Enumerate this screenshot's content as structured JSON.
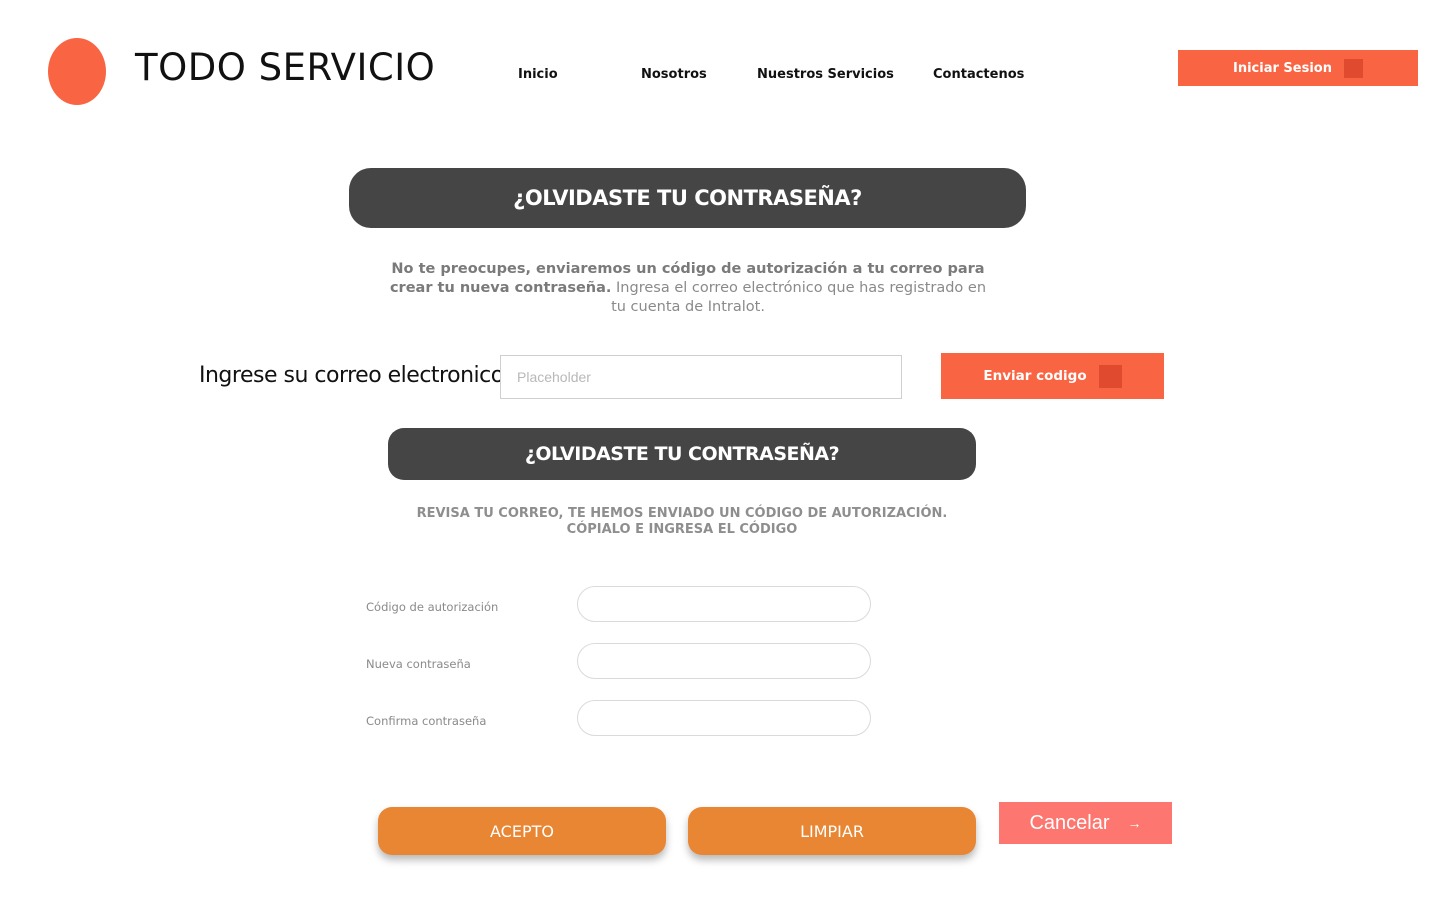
{
  "header": {
    "brand": "TODO SERVICIO",
    "nav": [
      {
        "label": "Inicio"
      },
      {
        "label": "Nosotros"
      },
      {
        "label": "Nuestros Servicios"
      },
      {
        "label": "Contactenos"
      }
    ],
    "login_label": "Iniciar Sesion"
  },
  "forgot": {
    "title": "¿OLVIDASTE TU CONTRASEÑA?",
    "description_bold": "No te preocupes, enviaremos un código de autorización a tu correo para crear tu nueva contraseña.",
    "description_rest": " Ingresa el correo electrónico que has registrado en tu cuenta de Intralot.",
    "email_label": "Ingrese su correo electronico",
    "email_placeholder": "Placeholder",
    "email_value": "",
    "send_label": "Enviar codigo"
  },
  "reset": {
    "title": "¿OLVIDASTE TU CONTRASEÑA?",
    "notice_line1": "REVISA TU CORREO, TE HEMOS ENVIADO UN CÓDIGO DE AUTORIZACIÓN.",
    "notice_line2": "CÓPIALO E INGRESA EL CÓDIGO",
    "fields": [
      {
        "label": "Código de autorización",
        "value": ""
      },
      {
        "label": "Nueva contraseña",
        "value": ""
      },
      {
        "label": "Confirma contraseña",
        "value": ""
      }
    ],
    "accept_label": "ACEPTO",
    "clear_label": "LIMPIAR",
    "cancel_label": "Cancelar",
    "cancel_icon": "arrow-right-icon"
  },
  "colors": {
    "accent": "#f96543",
    "dark_banner": "#454545",
    "pill_orange": "#e88633",
    "cancel": "#fd7670"
  }
}
